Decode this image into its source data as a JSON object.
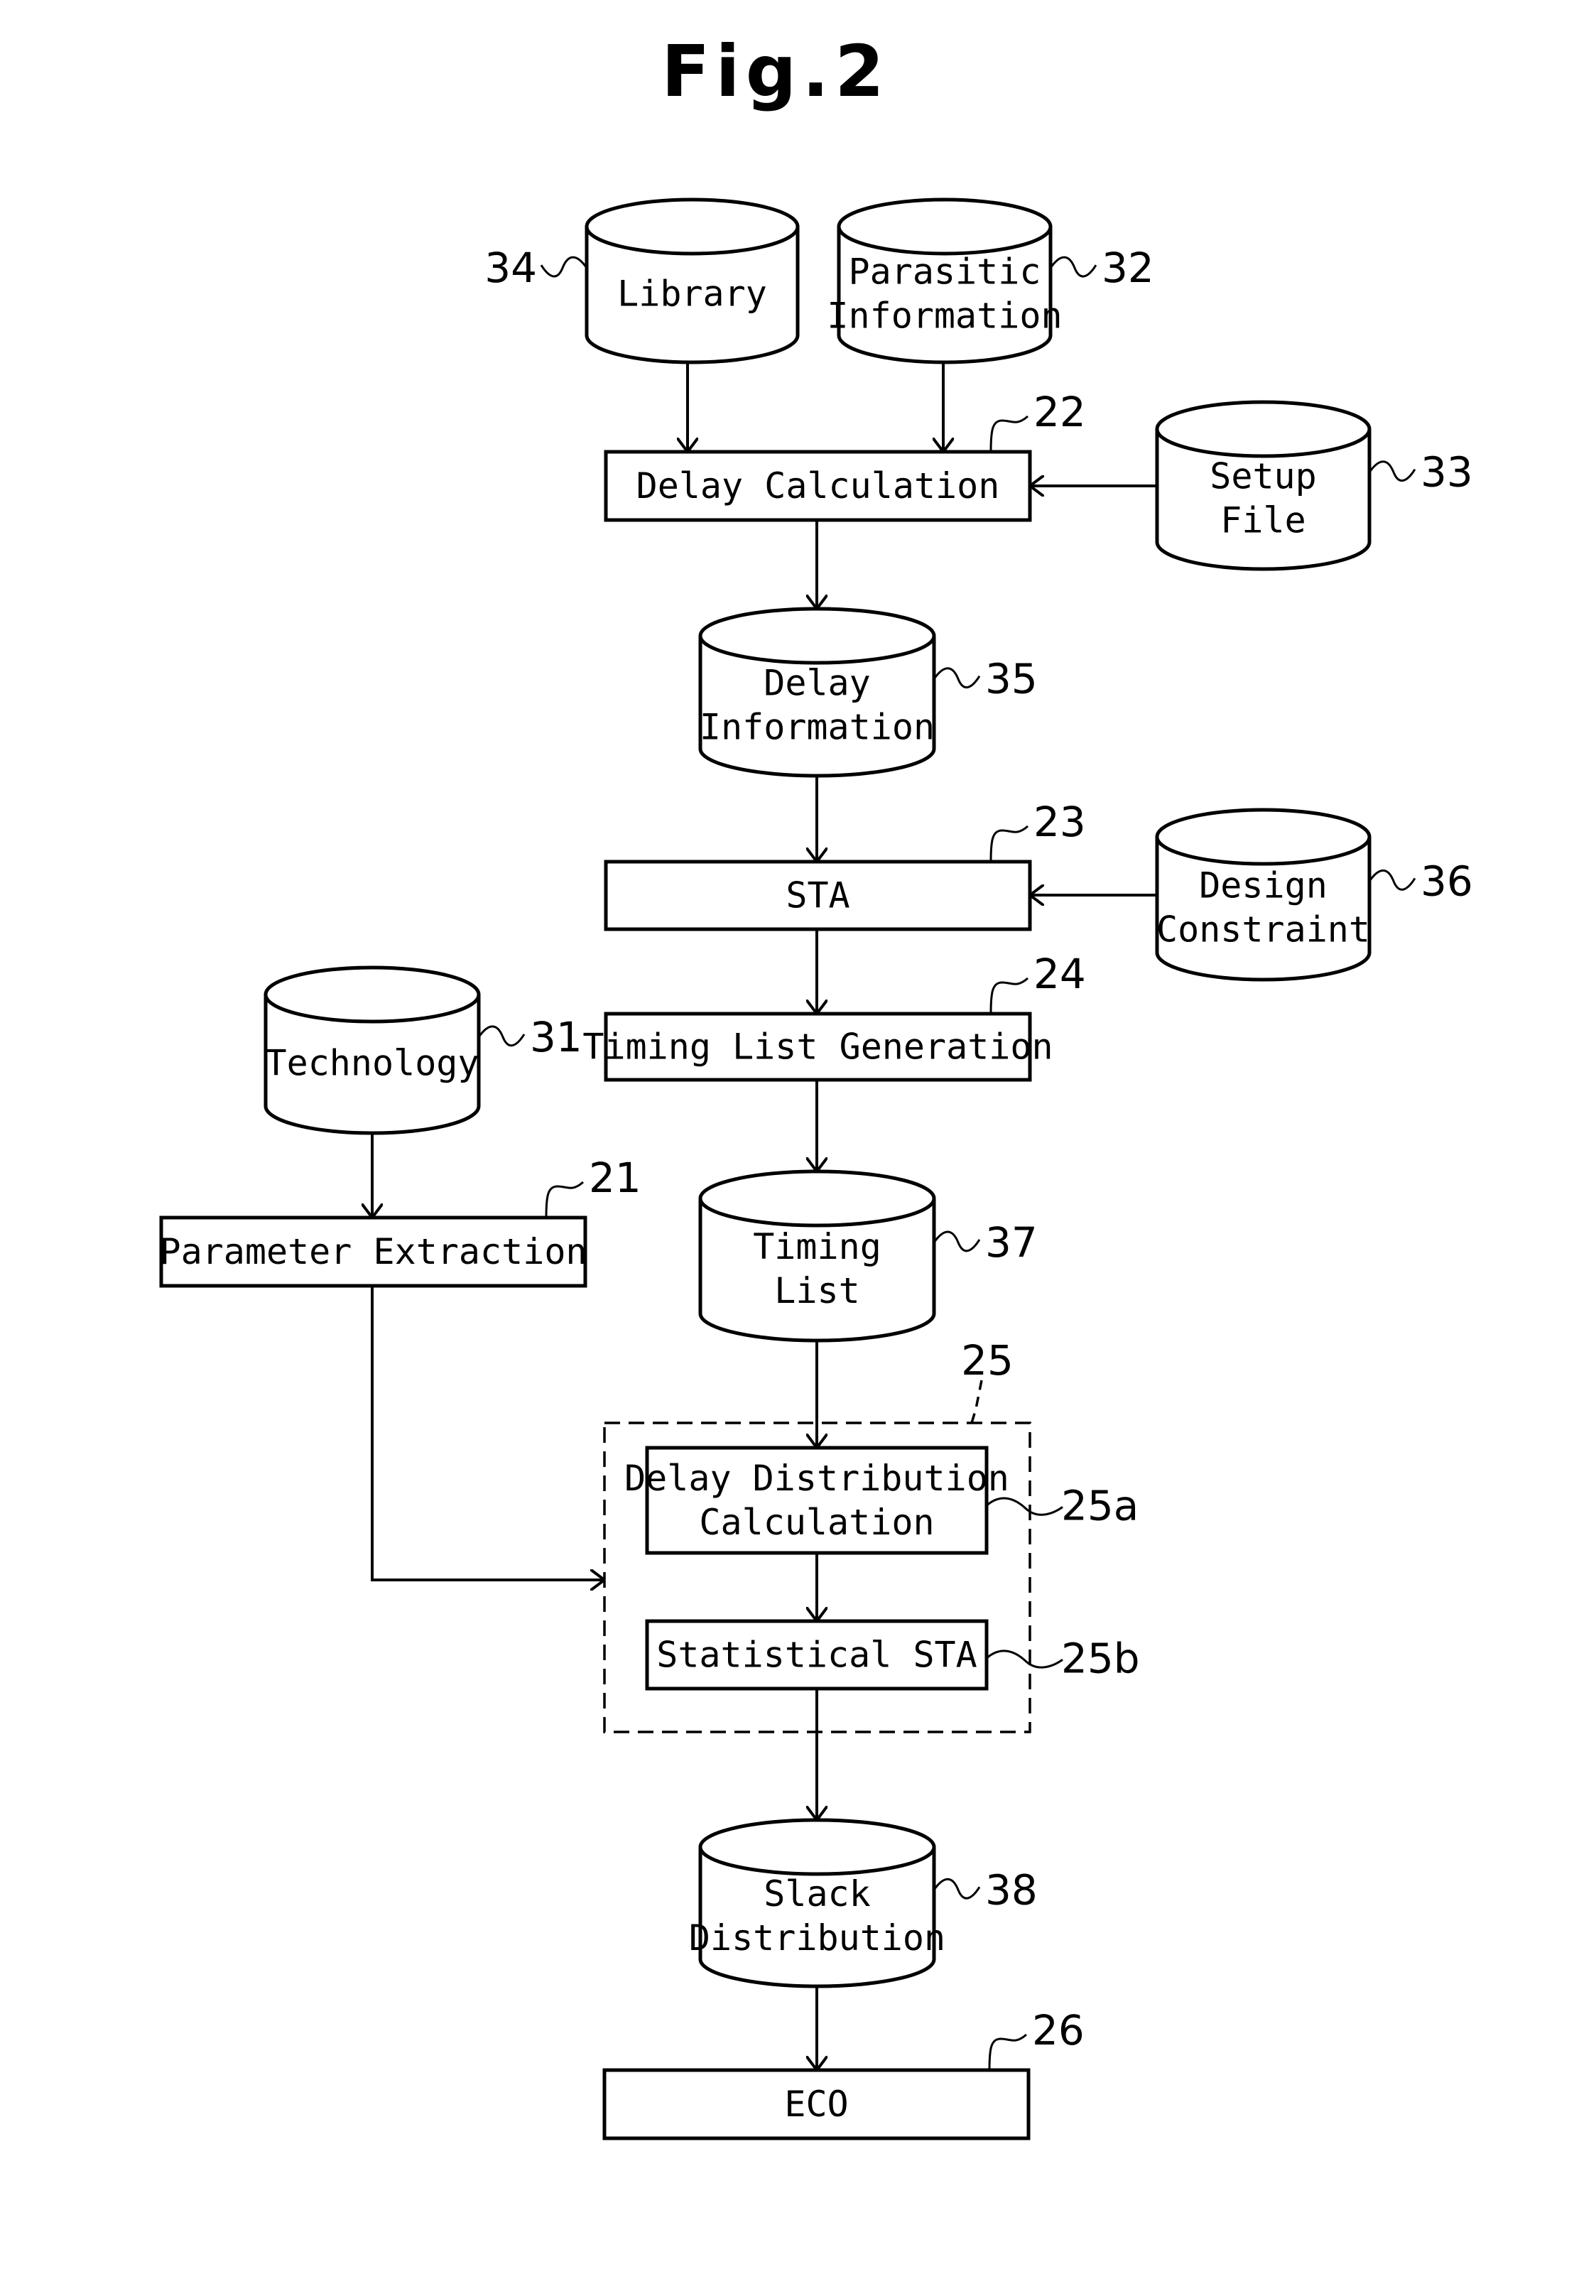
{
  "figure": {
    "title": "Fig.2"
  },
  "databases": {
    "library": {
      "lines": [
        "Library"
      ],
      "ref": "34"
    },
    "parasitic": {
      "lines": [
        "Parasitic",
        "Information"
      ],
      "ref": "32"
    },
    "setup_file": {
      "lines": [
        "Setup",
        "File"
      ],
      "ref": "33"
    },
    "delay_info": {
      "lines": [
        "Delay",
        "Information"
      ],
      "ref": "35"
    },
    "design_constraint": {
      "lines": [
        "Design",
        "Constraint"
      ],
      "ref": "36"
    },
    "technology": {
      "lines": [
        "Technology"
      ],
      "ref": "31"
    },
    "timing_list": {
      "lines": [
        "Timing",
        "List"
      ],
      "ref": "37"
    },
    "slack_dist": {
      "lines": [
        "Slack",
        "Distribution"
      ],
      "ref": "38"
    }
  },
  "processes": {
    "delay_calc": {
      "lines": [
        "Delay Calculation"
      ],
      "ref": "22"
    },
    "sta": {
      "lines": [
        "STA"
      ],
      "ref": "23"
    },
    "timing_list_gen": {
      "lines": [
        "Timing List Generation"
      ],
      "ref": "24"
    },
    "param_extract": {
      "lines": [
        "Parameter Extraction"
      ],
      "ref": "21"
    },
    "ddc": {
      "lines": [
        "Delay Distribution",
        "Calculation"
      ],
      "ref": "25a"
    },
    "ssta": {
      "lines": [
        "Statistical STA"
      ],
      "ref": "25b"
    },
    "eco": {
      "lines": [
        "ECO"
      ],
      "ref": "26"
    }
  },
  "group": {
    "statistical_unit": {
      "ref": "25"
    }
  }
}
